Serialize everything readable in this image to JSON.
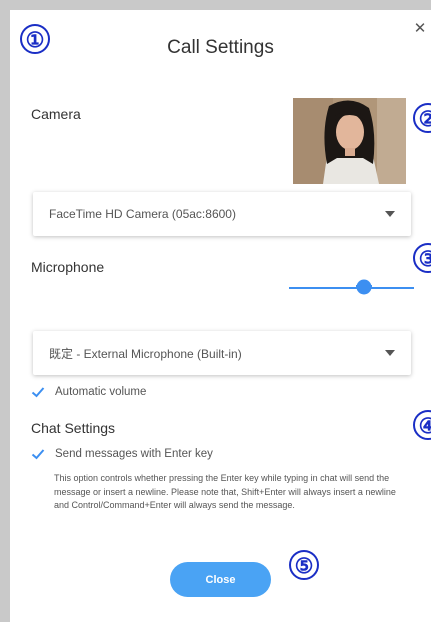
{
  "dialog": {
    "title": "Call Settings",
    "close_icon": "close-icon"
  },
  "camera": {
    "label": "Camera",
    "selected": "FaceTime HD Camera (05ac:8600)"
  },
  "microphone": {
    "label": "Microphone",
    "selected": "既定 - External Microphone (Built-in)",
    "volume_fraction": 0.6,
    "automatic_volume_label": "Automatic volume",
    "automatic_volume_checked": true
  },
  "chat": {
    "label": "Chat Settings",
    "enter_key_label": "Send messages with Enter key",
    "enter_key_checked": true,
    "enter_key_description": "This option controls whether pressing the Enter key while typing in chat will send the message or insert a newline. Please note that, Shift+Enter will always insert a newline and Control/Command+Enter will always send the message."
  },
  "footer": {
    "close_label": "Close"
  },
  "callouts": [
    "①",
    "②",
    "③",
    "④",
    "⑤"
  ],
  "colors": {
    "accent": "#3c8ff1",
    "button": "#4aa3f4",
    "callout": "#1a2ec5"
  }
}
